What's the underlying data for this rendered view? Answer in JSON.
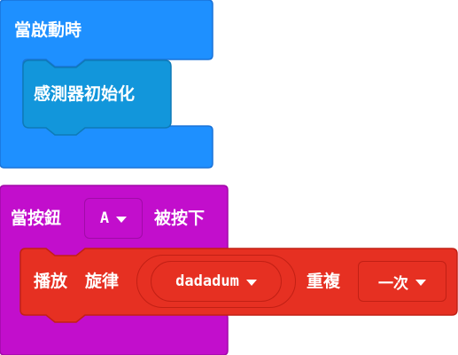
{
  "on_start": {
    "label": "當啟動時",
    "inner_block": {
      "label": "感測器初始化"
    }
  },
  "on_button": {
    "label_prefix": "當按鈕",
    "button_dropdown": {
      "value": "A"
    },
    "label_suffix": "被按下",
    "play_block": {
      "label_play": "播放",
      "label_melody": "旋律",
      "melody_dropdown": {
        "value": "dadadum"
      },
      "label_repeat": "重複",
      "repeat_dropdown": {
        "value": "一次"
      }
    }
  },
  "colors": {
    "on_start": "#1e90ff",
    "on_start_border": "#1a73d9",
    "sensor_block": "#1296db",
    "sensor_border": "#0e7ab7",
    "input_event": "#c20ecc",
    "input_border": "#a10aa8",
    "music": "#e63022",
    "music_border": "#c22015"
  }
}
